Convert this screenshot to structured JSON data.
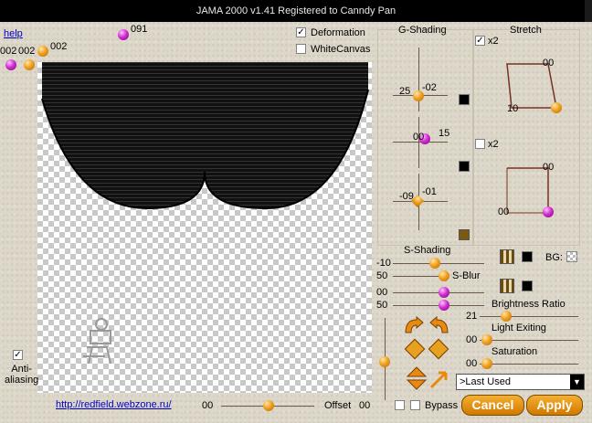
{
  "window": {
    "title": "JAMA 2000   v1.41  Registered to Canndy Pan"
  },
  "left": {
    "help": "help",
    "ball_labels": [
      "002",
      "002",
      "002"
    ],
    "top_value": "091",
    "antialias_label": "Anti-\naliasing",
    "url": "http://redfield.webzone.ru/"
  },
  "options": {
    "deformation": "Deformation",
    "white_canvas": "WhiteCanvas"
  },
  "gshading": {
    "title": "G-Shading",
    "s1": {
      "left": "25",
      "right": "-02"
    },
    "s2": {
      "left": "00",
      "right": "15"
    },
    "s3": {
      "left": "-09",
      "right": "-01"
    }
  },
  "stretch": {
    "title": "Stretch",
    "x2a": "x2",
    "x2b": "x2",
    "p1": {
      "tr": "00",
      "bl": "10"
    },
    "p2": {
      "tr": "00",
      "bl": "00"
    }
  },
  "sshading": {
    "title": "S-Shading",
    "v1": "-10",
    "v2": "50",
    "sblur": "S-Blur",
    "v3": "00",
    "v4": "50",
    "bg": "BG:"
  },
  "brightness": {
    "title": "Brightness Ratio",
    "value": "21"
  },
  "light": {
    "title": "Light Exiting",
    "value": "00"
  },
  "saturation": {
    "title": "Saturation",
    "value": "00"
  },
  "preset": {
    "selected": ">Last Used"
  },
  "offset": {
    "left": "00",
    "label": "Offset",
    "right": "00"
  },
  "bypass": {
    "label": "Bypass"
  },
  "buttons": {
    "cancel": "Cancel",
    "apply": "Apply"
  }
}
